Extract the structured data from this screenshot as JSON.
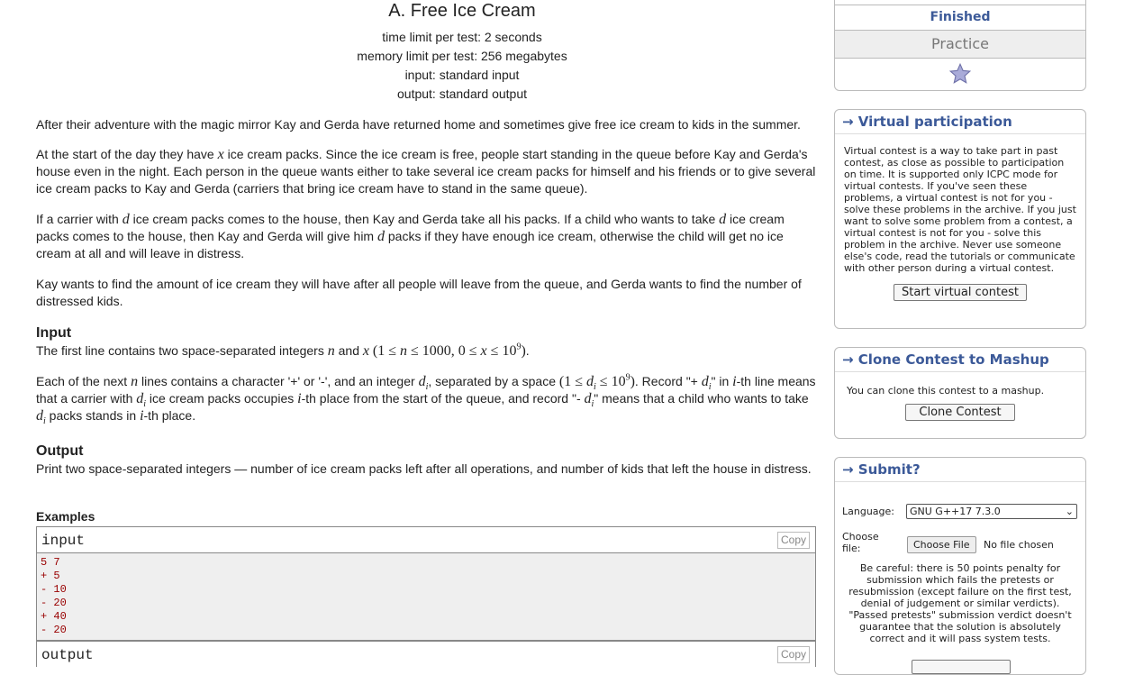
{
  "problem": {
    "title": "A. Free Ice Cream",
    "time_limit": "time limit per test: 2 seconds",
    "memory_limit": "memory limit per test: 256 megabytes",
    "input_file": "input: standard input",
    "output_file": "output: standard output",
    "p1": "After their adventure with the magic mirror Kay and Gerda have returned home and sometimes give free ice cream to kids in the summer.",
    "p2a": "At the start of the day they have ",
    "p2b": " ice cream packs. Since the ice cream is free, people start standing in the queue before Kay and Gerda's house even in the night. Each person in the queue wants either to take several ice cream packs for himself and his friends or to give several ice cream packs to Kay and Gerda (carriers that bring ice cream have to stand in the same queue).",
    "p3a": "If a carrier with ",
    "p3b": " ice cream packs comes to the house, then Kay and Gerda take all his packs. If a child who wants to take ",
    "p3c": " ice cream packs comes to the house, then Kay and Gerda will give him ",
    "p3d": " packs if they have enough ice cream, otherwise the child will get no ice cream at all and will leave in distress.",
    "p4": "Kay wants to find the amount of ice cream they will have after all people will leave from the queue, and Gerda wants to find the number of distressed kids.",
    "input_title": "Input",
    "input_p1a": "The first line contains two space-separated integers ",
    "input_p1b": " and ",
    "input_p2a": "Each of the next ",
    "input_p2b": " lines contains a character '+' or '-', and an integer ",
    "input_p2c": ", separated by a space ",
    "input_p2d": ". Record \"+  ",
    "input_p2e": "\" in ",
    "input_p2f": "-th line means that a carrier with ",
    "input_p2g": " ice cream packs occupies ",
    "input_p2h": "-th place from the start of the queue, and record \"-  ",
    "input_p2i": "\" means that a child who wants to take ",
    "input_p2j": " packs stands in ",
    "input_p2k": "-th place.",
    "output_title": "Output",
    "output_p": "Print two space-separated integers — number of ice cream packs left after all operations, and number of kids that left the house in distress.",
    "examples_title": "Examples",
    "input_label": "input",
    "output_label": "output",
    "copy_label": "Copy",
    "example_input": [
      "5 7",
      "+ 5",
      "- 10",
      "- 20",
      "+ 40",
      "- 20"
    ]
  },
  "sidebar": {
    "status": "Finished",
    "mode": "Practice",
    "virtual": {
      "caption": "→ Virtual participation",
      "text": "Virtual contest is a way to take part in past contest, as close as possible to participation on time. It is supported only ICPC mode for virtual contests. If you've seen these problems, a virtual contest is not for you - solve these problems in the archive. If you just want to solve some problem from a contest, a virtual contest is not for you - solve this problem in the archive. Never use someone else's code, read the tutorials or communicate with other person during a virtual contest.",
      "button": "Start virtual contest"
    },
    "clone": {
      "caption": "→ Clone Contest to Mashup",
      "text": "You can clone this contest to a mashup.",
      "button": "Clone Contest"
    },
    "submit": {
      "caption": "→ Submit?",
      "language_label": "Language:",
      "language_value": "GNU G++17 7.3.0",
      "file_label": "Choose file:",
      "file_button": "Choose File",
      "file_status": "No file chosen",
      "warning": "Be careful: there is 50 points penalty for submission which fails the pretests or resubmission (except failure on the first test, denial of judgement or similar verdicts). \"Passed pretests\" submission verdict doesn't guarantee that the solution is absolutely correct and it will pass system tests."
    }
  },
  "colors": {
    "accent": "#3b5998",
    "example_text": "#990000",
    "example_bg": "#efefef"
  }
}
